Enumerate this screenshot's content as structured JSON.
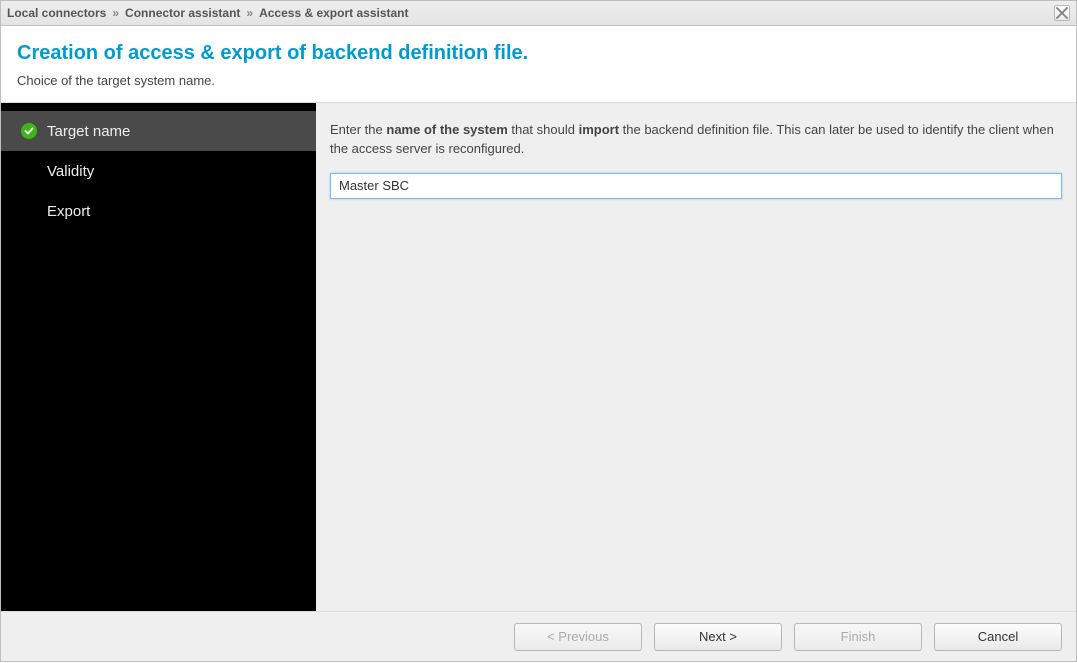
{
  "breadcrumb": {
    "item1": "Local connectors",
    "item2": "Connector assistant",
    "item3": "Access & export assistant"
  },
  "header": {
    "title": "Creation of access & export of backend definition file.",
    "subtitle": "Choice of the target system name."
  },
  "sidebar": {
    "steps": [
      {
        "label": "Target name"
      },
      {
        "label": "Validity"
      },
      {
        "label": "Export"
      }
    ]
  },
  "main": {
    "instruction_pre": "Enter the ",
    "instruction_bold1": "name of the system",
    "instruction_mid": " that should ",
    "instruction_bold2": "import",
    "instruction_post": " the backend definition file. This can later be used to identify the client when the access server is reconfigured.",
    "input_value": "Master SBC"
  },
  "footer": {
    "previous": "< Previous",
    "next": "Next >",
    "finish": "Finish",
    "cancel": "Cancel"
  }
}
